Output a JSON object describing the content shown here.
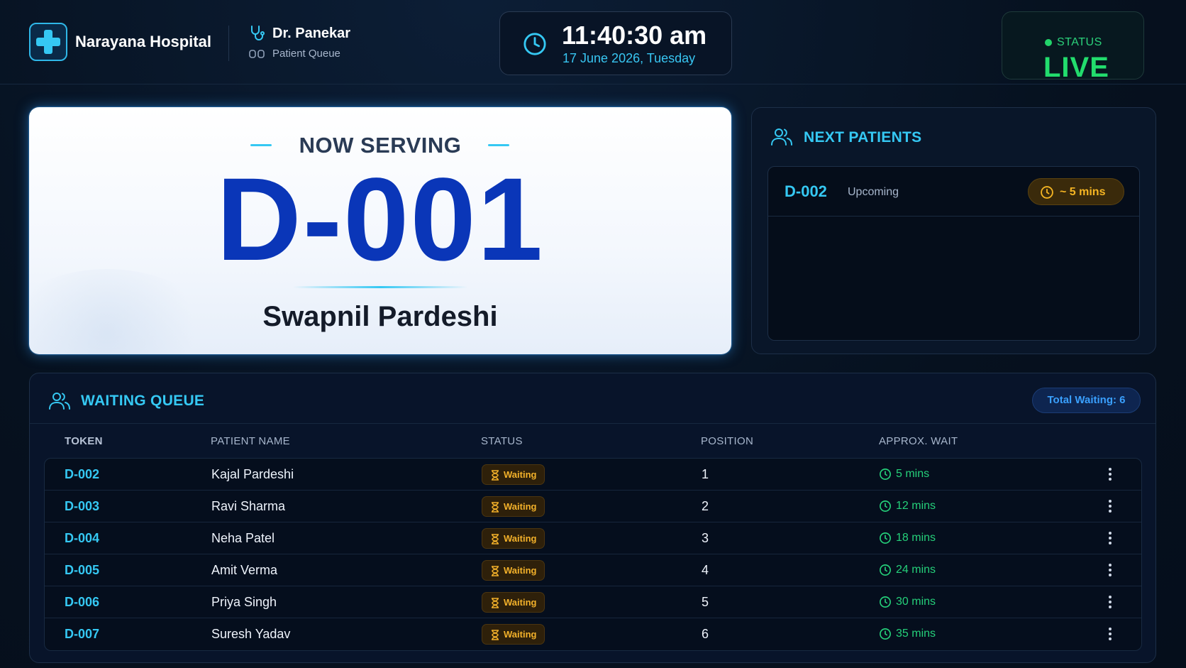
{
  "header": {
    "hospital_name": "Narayana Hospital",
    "doctor_name": "Dr. Panekar",
    "queue_label": "Patient Queue",
    "clock": {
      "time": "11:40:30 am",
      "date": "17 June 2026, Tuesday"
    },
    "status": {
      "label": "STATUS",
      "value": "LIVE",
      "color": "#22dd6d"
    }
  },
  "now_serving": {
    "heading": "NOW SERVING",
    "token": "D-001",
    "patient_name": "Swapnil Pardeshi"
  },
  "next_patients": {
    "title": "NEXT PATIENTS",
    "items": [
      {
        "token": "D-002",
        "status": "Upcoming",
        "wait": "~ 5 mins"
      }
    ]
  },
  "waiting_queue": {
    "title": "WAITING QUEUE",
    "total_label": "Total Waiting: 6",
    "columns": [
      "TOKEN",
      "PATIENT NAME",
      "STATUS",
      "POSITION",
      "APPROX. WAIT"
    ],
    "rows": [
      {
        "token": "D-002",
        "name": "Kajal Pardeshi",
        "status": "Waiting",
        "position": "1",
        "wait": "5 mins"
      },
      {
        "token": "D-003",
        "name": "Ravi Sharma",
        "status": "Waiting",
        "position": "2",
        "wait": "12 mins"
      },
      {
        "token": "D-004",
        "name": "Neha Patel",
        "status": "Waiting",
        "position": "3",
        "wait": "18 mins"
      },
      {
        "token": "D-005",
        "name": "Amit Verma",
        "status": "Waiting",
        "position": "4",
        "wait": "24 mins"
      },
      {
        "token": "D-006",
        "name": "Priya Singh",
        "status": "Waiting",
        "position": "5",
        "wait": "30 mins"
      },
      {
        "token": "D-007",
        "name": "Suresh Yadav",
        "status": "Waiting",
        "position": "6",
        "wait": "35 mins"
      }
    ]
  },
  "colors": {
    "accent": "#35c8f3",
    "token_blue": "#0a36b8",
    "waiting": "#f3b12a",
    "wait_time": "#25d07a"
  }
}
